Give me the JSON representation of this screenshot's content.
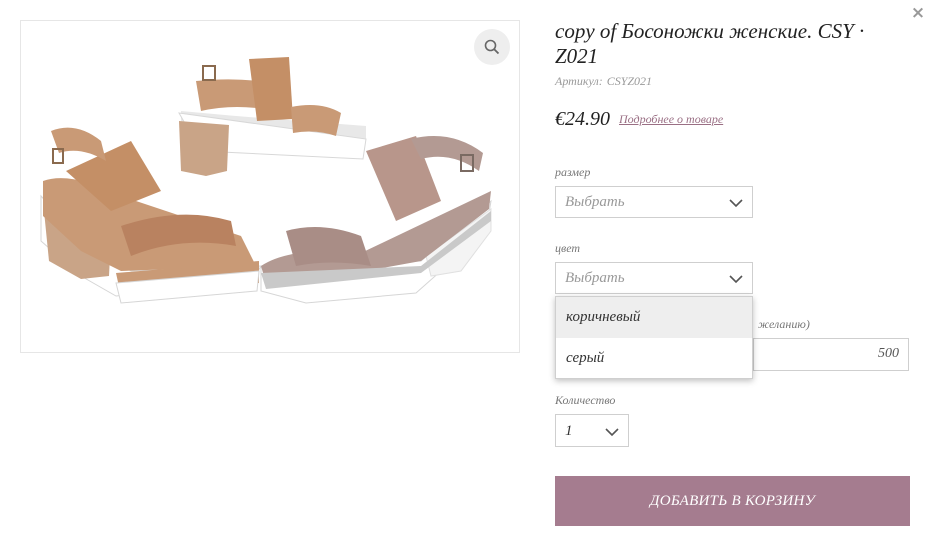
{
  "modal": {
    "close_icon": "×"
  },
  "product": {
    "title": "copy of Босоножки женские. CSY · Z021",
    "sku_label": "Артикул:",
    "sku_value": "CSYZ021",
    "price": "€24.90",
    "details_link": "Подробнее о товаре",
    "image_icon": "sandals-photo",
    "zoom_icon": "magnifier-icon"
  },
  "options": {
    "size": {
      "label": "размер",
      "value": "Выбрать"
    },
    "color": {
      "label": "цвет",
      "value": "Выбрать",
      "items": [
        "коричневый",
        "серый"
      ]
    },
    "amount": {
      "label_fragment": "желанию)",
      "value": "500"
    },
    "quantity": {
      "label": "Количество",
      "value": "1"
    }
  },
  "actions": {
    "add_to_cart": "ДОБАВИТЬ В КОРЗИНУ"
  },
  "colors": {
    "accent": "#a57c8f",
    "link": "#9a6f84",
    "border": "#cfcfcf",
    "sandal_tan": "#c99a76",
    "sandal_gray": "#b39a93"
  }
}
